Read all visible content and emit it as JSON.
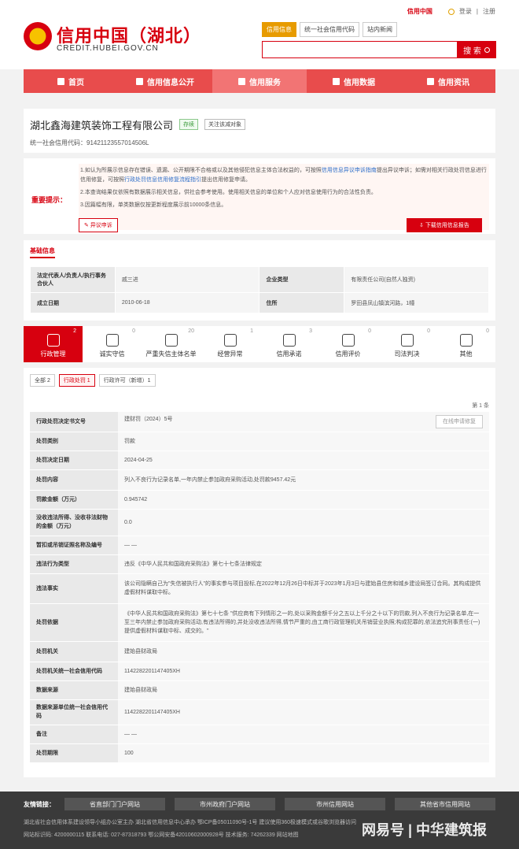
{
  "topbar": {
    "brand": "信用中国",
    "login": "登录",
    "separator": "|",
    "register": "注册"
  },
  "header": {
    "title": "信用中国（湖北）",
    "domain": "CREDIT.HUBEI.GOV.CN",
    "search_tabs": [
      "信用信息",
      "统一社会信用代码",
      "站内新闻"
    ],
    "search_placeholder": "",
    "search_button": "搜 索"
  },
  "nav": [
    "首页",
    "信用信息公开",
    "信用服务",
    "信用数据",
    "信用资讯"
  ],
  "company": {
    "name": "湖北鑫海建筑装饰工程有限公司",
    "status": "存续",
    "follow": "关注该减对象",
    "credit_code": "统一社会信用代码：91421123557014506L"
  },
  "notice": {
    "label": "重要提示：",
    "line1a": "1.如认为所展示信息存在错误、遗漏、公开期限不合格或以及其他侵犯信息主体合法权益的，可按照",
    "line1_link": "信用信息异议申诉指南",
    "line1b": "提出异议申诉；如需对相关行政处罚信息进行信用修复，可按照",
    "line1_link2": "行政处罚信息信用修复流程",
    "line1c": "指引",
    "line1d": "提出信用修复申请。",
    "line2": "2.本查询结果仅依照有数据展示相关信息，供社会参考使用。使用相关信息的单位和个人应对信息使用行为的合法性负责。",
    "line3": "3.因篇幅有限，单类数据仅按更新程度展示前10000条信息。",
    "objection_button": "异议申诉",
    "download_button": "下载信用信息报告"
  },
  "basic": {
    "title": "基础信息",
    "rows": [
      [
        "法定代表人/负责人/执行事务合伙人",
        "戚三进",
        "企业类型",
        "有限责任公司(自然人独资)"
      ],
      [
        "成立日期",
        "2010-06-18",
        "住所",
        "罗田县凤山镇滨河路，1幢"
      ]
    ]
  },
  "categories": [
    {
      "label": "行政管理",
      "count": "2"
    },
    {
      "label": "诚实守信",
      "count": "0"
    },
    {
      "label": "严重失信主体名单",
      "count": "20"
    },
    {
      "label": "经营异常",
      "count": "1"
    },
    {
      "label": "信用承诺",
      "count": "3"
    },
    {
      "label": "信用评价",
      "count": "0"
    },
    {
      "label": "司法判决",
      "count": "0"
    },
    {
      "label": "其他",
      "count": "0"
    }
  ],
  "records": {
    "subtabs": [
      "全部 2",
      "行政处罚 1",
      "行政许可（新增）1"
    ],
    "count": "第 1 条",
    "repair_button": "在线申请修复",
    "rows": [
      [
        "行政处罚决定书文号",
        "建财罚（2024）5号"
      ],
      [
        "处罚类别",
        "罚款"
      ],
      [
        "处罚决定日期",
        "2024-04-25"
      ],
      [
        "处罚内容",
        "列入不良行为记录名单,一年内禁止参加政府采购活动,处罚款9457.42元"
      ],
      [
        "罚款金额（万元）",
        "0.945742"
      ],
      [
        "没收违法所得、没收非法财物的金额（万元）",
        "0.0"
      ],
      [
        "暂扣或吊销证照名称及编号",
        "— —"
      ],
      [
        "违法行为类型",
        "违反《中华人民共和国政府采购法》第七十七条法律规定"
      ],
      [
        "违法事实",
        "该公司隐瞒自己为\"失信被执行人\"的事实参与项目投标,在2022年12月26日中标并于2023年1月3日与建始县住房和城乡建设局签订合同。其构成提供虚假材料谋取中标。"
      ],
      [
        "处罚依据",
        "《中华人民共和国政府采购法》第七十七条 \"供应商有下列情形之一的,处以采购金额千分之五以上千分之十以下的罚款,列入不良行为记录名单,在一至三年内禁止参加政府采购活动,有违法所得的,并处没收违法所得,情节严重的,由工商行政管理机关吊销营业执照;构成犯罪的,依法追究刑事责任:(一)提供虚假材料谋取中标、成交的。\""
      ],
      [
        "处罚机关",
        "建始县财政局"
      ],
      [
        "处罚机关统一社会信用代码",
        "114228220114740​5XH"
      ],
      [
        "数据来源",
        "建始县财政局"
      ],
      [
        "数据来源单位统一社会信用代码",
        "1142282201147405XH"
      ],
      [
        "备注",
        "— —"
      ],
      [
        "处罚期限",
        "100"
      ]
    ]
  },
  "footer": {
    "links_label": "友情链接：",
    "links": [
      "省直部门门户网站",
      "市州政府门户网站",
      "市州信用网站",
      "其他省市信用网站"
    ],
    "line1": "湖北省社会信用体系建设领导小组办公室主办    湖北省信用信息中心承办    鄂ICP备05011090号-1号    建议使用360极速模式或谷歌浏览器访问",
    "line2": "网站标识码: 4200000115    联系电话: 027-87318793    鄂公网安备42010602000928号    技术服务: 74262339    网站地图",
    "watermark": "网易号 | 中华建筑报"
  }
}
